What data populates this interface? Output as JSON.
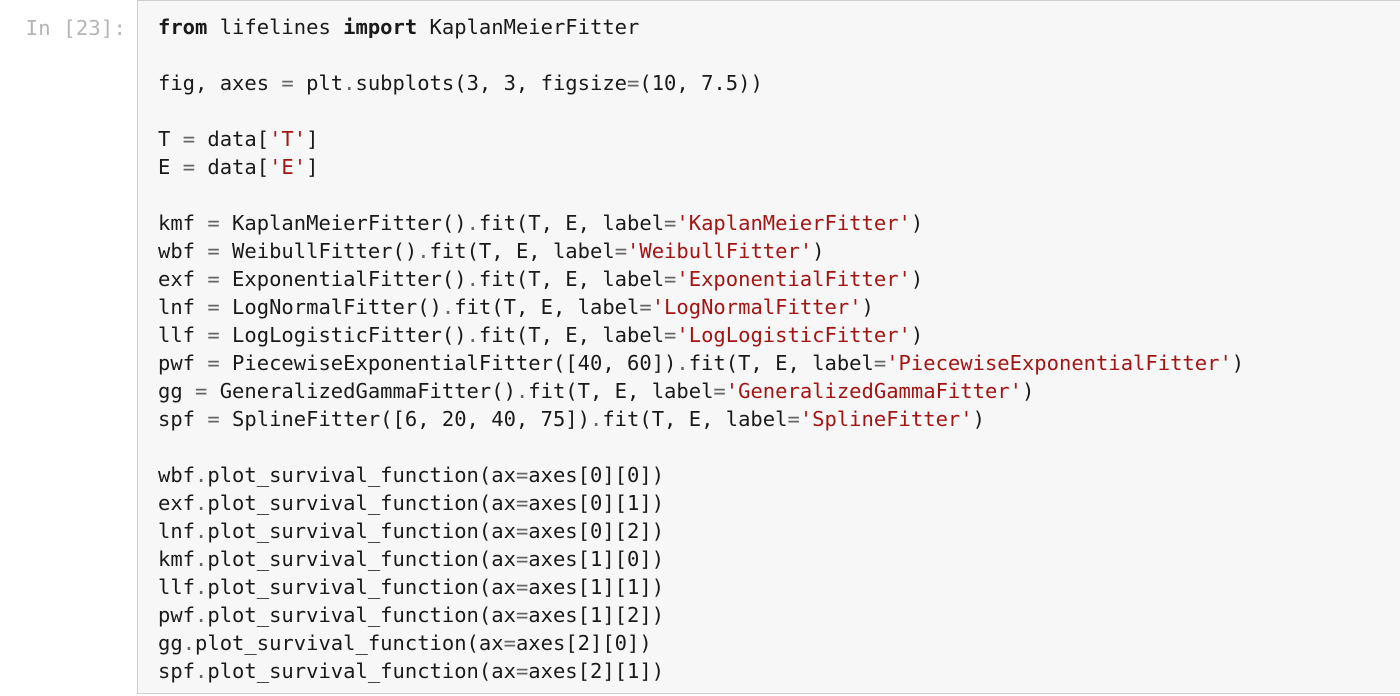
{
  "cell": {
    "prompt": "In [23]:",
    "code_lines": [
      [
        {
          "t": "kw",
          "v": "from"
        },
        {
          "t": "name",
          "v": " lifelines "
        },
        {
          "t": "kw",
          "v": "import"
        },
        {
          "t": "name",
          "v": " KaplanMeierFitter"
        }
      ],
      [],
      [
        {
          "t": "name",
          "v": "fig, axes "
        },
        {
          "t": "op",
          "v": "="
        },
        {
          "t": "name",
          "v": " plt"
        },
        {
          "t": "op",
          "v": "."
        },
        {
          "t": "name",
          "v": "subplots(3, 3, figsize"
        },
        {
          "t": "op",
          "v": "="
        },
        {
          "t": "name",
          "v": "(10, 7.5))"
        }
      ],
      [],
      [
        {
          "t": "name",
          "v": "T "
        },
        {
          "t": "op",
          "v": "="
        },
        {
          "t": "name",
          "v": " data["
        },
        {
          "t": "str",
          "v": "'T'"
        },
        {
          "t": "name",
          "v": "]"
        }
      ],
      [
        {
          "t": "name",
          "v": "E "
        },
        {
          "t": "op",
          "v": "="
        },
        {
          "t": "name",
          "v": " data["
        },
        {
          "t": "str",
          "v": "'E'"
        },
        {
          "t": "name",
          "v": "]"
        }
      ],
      [],
      [
        {
          "t": "name",
          "v": "kmf "
        },
        {
          "t": "op",
          "v": "="
        },
        {
          "t": "name",
          "v": " KaplanMeierFitter()"
        },
        {
          "t": "op",
          "v": "."
        },
        {
          "t": "name",
          "v": "fit(T, E, label"
        },
        {
          "t": "op",
          "v": "="
        },
        {
          "t": "str",
          "v": "'KaplanMeierFitter'"
        },
        {
          "t": "name",
          "v": ")"
        }
      ],
      [
        {
          "t": "name",
          "v": "wbf "
        },
        {
          "t": "op",
          "v": "="
        },
        {
          "t": "name",
          "v": " WeibullFitter()"
        },
        {
          "t": "op",
          "v": "."
        },
        {
          "t": "name",
          "v": "fit(T, E, label"
        },
        {
          "t": "op",
          "v": "="
        },
        {
          "t": "str",
          "v": "'WeibullFitter'"
        },
        {
          "t": "name",
          "v": ")"
        }
      ],
      [
        {
          "t": "name",
          "v": "exf "
        },
        {
          "t": "op",
          "v": "="
        },
        {
          "t": "name",
          "v": " ExponentialFitter()"
        },
        {
          "t": "op",
          "v": "."
        },
        {
          "t": "name",
          "v": "fit(T, E, label"
        },
        {
          "t": "op",
          "v": "="
        },
        {
          "t": "str",
          "v": "'ExponentialFitter'"
        },
        {
          "t": "name",
          "v": ")"
        }
      ],
      [
        {
          "t": "name",
          "v": "lnf "
        },
        {
          "t": "op",
          "v": "="
        },
        {
          "t": "name",
          "v": " LogNormalFitter()"
        },
        {
          "t": "op",
          "v": "."
        },
        {
          "t": "name",
          "v": "fit(T, E, label"
        },
        {
          "t": "op",
          "v": "="
        },
        {
          "t": "str",
          "v": "'LogNormalFitter'"
        },
        {
          "t": "name",
          "v": ")"
        }
      ],
      [
        {
          "t": "name",
          "v": "llf "
        },
        {
          "t": "op",
          "v": "="
        },
        {
          "t": "name",
          "v": " LogLogisticFitter()"
        },
        {
          "t": "op",
          "v": "."
        },
        {
          "t": "name",
          "v": "fit(T, E, label"
        },
        {
          "t": "op",
          "v": "="
        },
        {
          "t": "str",
          "v": "'LogLogisticFitter'"
        },
        {
          "t": "name",
          "v": ")"
        }
      ],
      [
        {
          "t": "name",
          "v": "pwf "
        },
        {
          "t": "op",
          "v": "="
        },
        {
          "t": "name",
          "v": " PiecewiseExponentialFitter([40, 60])"
        },
        {
          "t": "op",
          "v": "."
        },
        {
          "t": "name",
          "v": "fit(T, E, label"
        },
        {
          "t": "op",
          "v": "="
        },
        {
          "t": "str",
          "v": "'PiecewiseExponentialFitter'"
        },
        {
          "t": "name",
          "v": ")"
        }
      ],
      [
        {
          "t": "name",
          "v": "gg "
        },
        {
          "t": "op",
          "v": "="
        },
        {
          "t": "name",
          "v": " GeneralizedGammaFitter()"
        },
        {
          "t": "op",
          "v": "."
        },
        {
          "t": "name",
          "v": "fit(T, E, label"
        },
        {
          "t": "op",
          "v": "="
        },
        {
          "t": "str",
          "v": "'GeneralizedGammaFitter'"
        },
        {
          "t": "name",
          "v": ")"
        }
      ],
      [
        {
          "t": "name",
          "v": "spf "
        },
        {
          "t": "op",
          "v": "="
        },
        {
          "t": "name",
          "v": " SplineFitter([6, 20, 40, 75])"
        },
        {
          "t": "op",
          "v": "."
        },
        {
          "t": "name",
          "v": "fit(T, E, label"
        },
        {
          "t": "op",
          "v": "="
        },
        {
          "t": "str",
          "v": "'SplineFitter'"
        },
        {
          "t": "name",
          "v": ")"
        }
      ],
      [],
      [
        {
          "t": "name",
          "v": "wbf"
        },
        {
          "t": "op",
          "v": "."
        },
        {
          "t": "name",
          "v": "plot_survival_function(ax"
        },
        {
          "t": "op",
          "v": "="
        },
        {
          "t": "name",
          "v": "axes[0][0])"
        }
      ],
      [
        {
          "t": "name",
          "v": "exf"
        },
        {
          "t": "op",
          "v": "."
        },
        {
          "t": "name",
          "v": "plot_survival_function(ax"
        },
        {
          "t": "op",
          "v": "="
        },
        {
          "t": "name",
          "v": "axes[0][1])"
        }
      ],
      [
        {
          "t": "name",
          "v": "lnf"
        },
        {
          "t": "op",
          "v": "."
        },
        {
          "t": "name",
          "v": "plot_survival_function(ax"
        },
        {
          "t": "op",
          "v": "="
        },
        {
          "t": "name",
          "v": "axes[0][2])"
        }
      ],
      [
        {
          "t": "name",
          "v": "kmf"
        },
        {
          "t": "op",
          "v": "."
        },
        {
          "t": "name",
          "v": "plot_survival_function(ax"
        },
        {
          "t": "op",
          "v": "="
        },
        {
          "t": "name",
          "v": "axes[1][0])"
        }
      ],
      [
        {
          "t": "name",
          "v": "llf"
        },
        {
          "t": "op",
          "v": "."
        },
        {
          "t": "name",
          "v": "plot_survival_function(ax"
        },
        {
          "t": "op",
          "v": "="
        },
        {
          "t": "name",
          "v": "axes[1][1])"
        }
      ],
      [
        {
          "t": "name",
          "v": "pwf"
        },
        {
          "t": "op",
          "v": "."
        },
        {
          "t": "name",
          "v": "plot_survival_function(ax"
        },
        {
          "t": "op",
          "v": "="
        },
        {
          "t": "name",
          "v": "axes[1][2])"
        }
      ],
      [
        {
          "t": "name",
          "v": "gg"
        },
        {
          "t": "op",
          "v": "."
        },
        {
          "t": "name",
          "v": "plot_survival_function(ax"
        },
        {
          "t": "op",
          "v": "="
        },
        {
          "t": "name",
          "v": "axes[2][0])"
        }
      ],
      [
        {
          "t": "name",
          "v": "spf"
        },
        {
          "t": "op",
          "v": "."
        },
        {
          "t": "name",
          "v": "plot_survival_function(ax"
        },
        {
          "t": "op",
          "v": "="
        },
        {
          "t": "name",
          "v": "axes[2][1])"
        }
      ]
    ]
  },
  "colors": {
    "prompt": "#b5b5b5",
    "cell_background": "#f7f7f7",
    "cell_border": "#cfcfcf",
    "string": "#a31515",
    "operator": "#666666",
    "text": "#1a1a1a"
  }
}
